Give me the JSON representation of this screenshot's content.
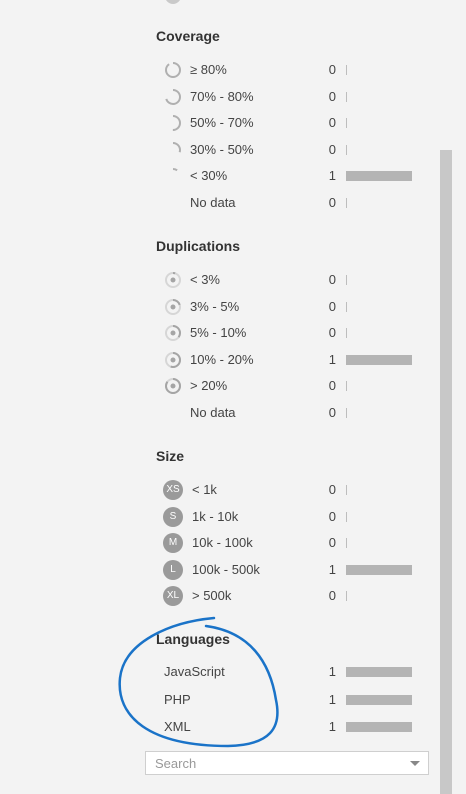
{
  "coverage": {
    "title": "Coverage",
    "rows": [
      {
        "label": "≥ 80%",
        "count": "0",
        "fraction": 0,
        "icon": "coverage-80-icon"
      },
      {
        "label": "70% - 80%",
        "count": "0",
        "fraction": 0,
        "icon": "coverage-70-icon"
      },
      {
        "label": "50% - 70%",
        "count": "0",
        "fraction": 0,
        "icon": "coverage-50-icon"
      },
      {
        "label": "30% - 50%",
        "count": "0",
        "fraction": 0,
        "icon": "coverage-30-icon"
      },
      {
        "label": "< 30%",
        "count": "1",
        "fraction": 1,
        "icon": "coverage-low-icon"
      },
      {
        "label": "No data",
        "count": "0",
        "fraction": 0,
        "icon": ""
      }
    ]
  },
  "duplications": {
    "title": "Duplications",
    "rows": [
      {
        "label": "< 3%",
        "count": "0",
        "fraction": 0,
        "icon": "duplication-3-icon"
      },
      {
        "label": "3% - 5%",
        "count": "0",
        "fraction": 0,
        "icon": "duplication-5-icon"
      },
      {
        "label": "5% - 10%",
        "count": "0",
        "fraction": 0,
        "icon": "duplication-10-icon"
      },
      {
        "label": "10% - 20%",
        "count": "1",
        "fraction": 1,
        "icon": "duplication-20-icon"
      },
      {
        "label": "> 20%",
        "count": "0",
        "fraction": 0,
        "icon": "duplication-high-icon"
      },
      {
        "label": "No data",
        "count": "0",
        "fraction": 0,
        "icon": ""
      }
    ]
  },
  "size": {
    "title": "Size",
    "rows": [
      {
        "badge": "XS",
        "label": "< 1k",
        "count": "0",
        "fraction": 0
      },
      {
        "badge": "S",
        "label": "1k - 10k",
        "count": "0",
        "fraction": 0
      },
      {
        "badge": "M",
        "label": "10k - 100k",
        "count": "0",
        "fraction": 0
      },
      {
        "badge": "L",
        "label": "100k - 500k",
        "count": "1",
        "fraction": 1
      },
      {
        "badge": "XL",
        "label": "> 500k",
        "count": "0",
        "fraction": 0
      }
    ]
  },
  "languages": {
    "title": "Languages",
    "rows": [
      {
        "label": "JavaScript",
        "count": "1",
        "fraction": 1
      },
      {
        "label": "PHP",
        "count": "1",
        "fraction": 1
      },
      {
        "label": "XML",
        "count": "1",
        "fraction": 1
      }
    ]
  },
  "search": {
    "placeholder": "Search"
  },
  "colors": {
    "bar": "#b4b4b4",
    "annotation": "#1a73c8",
    "icon": "#b0b0b0"
  }
}
